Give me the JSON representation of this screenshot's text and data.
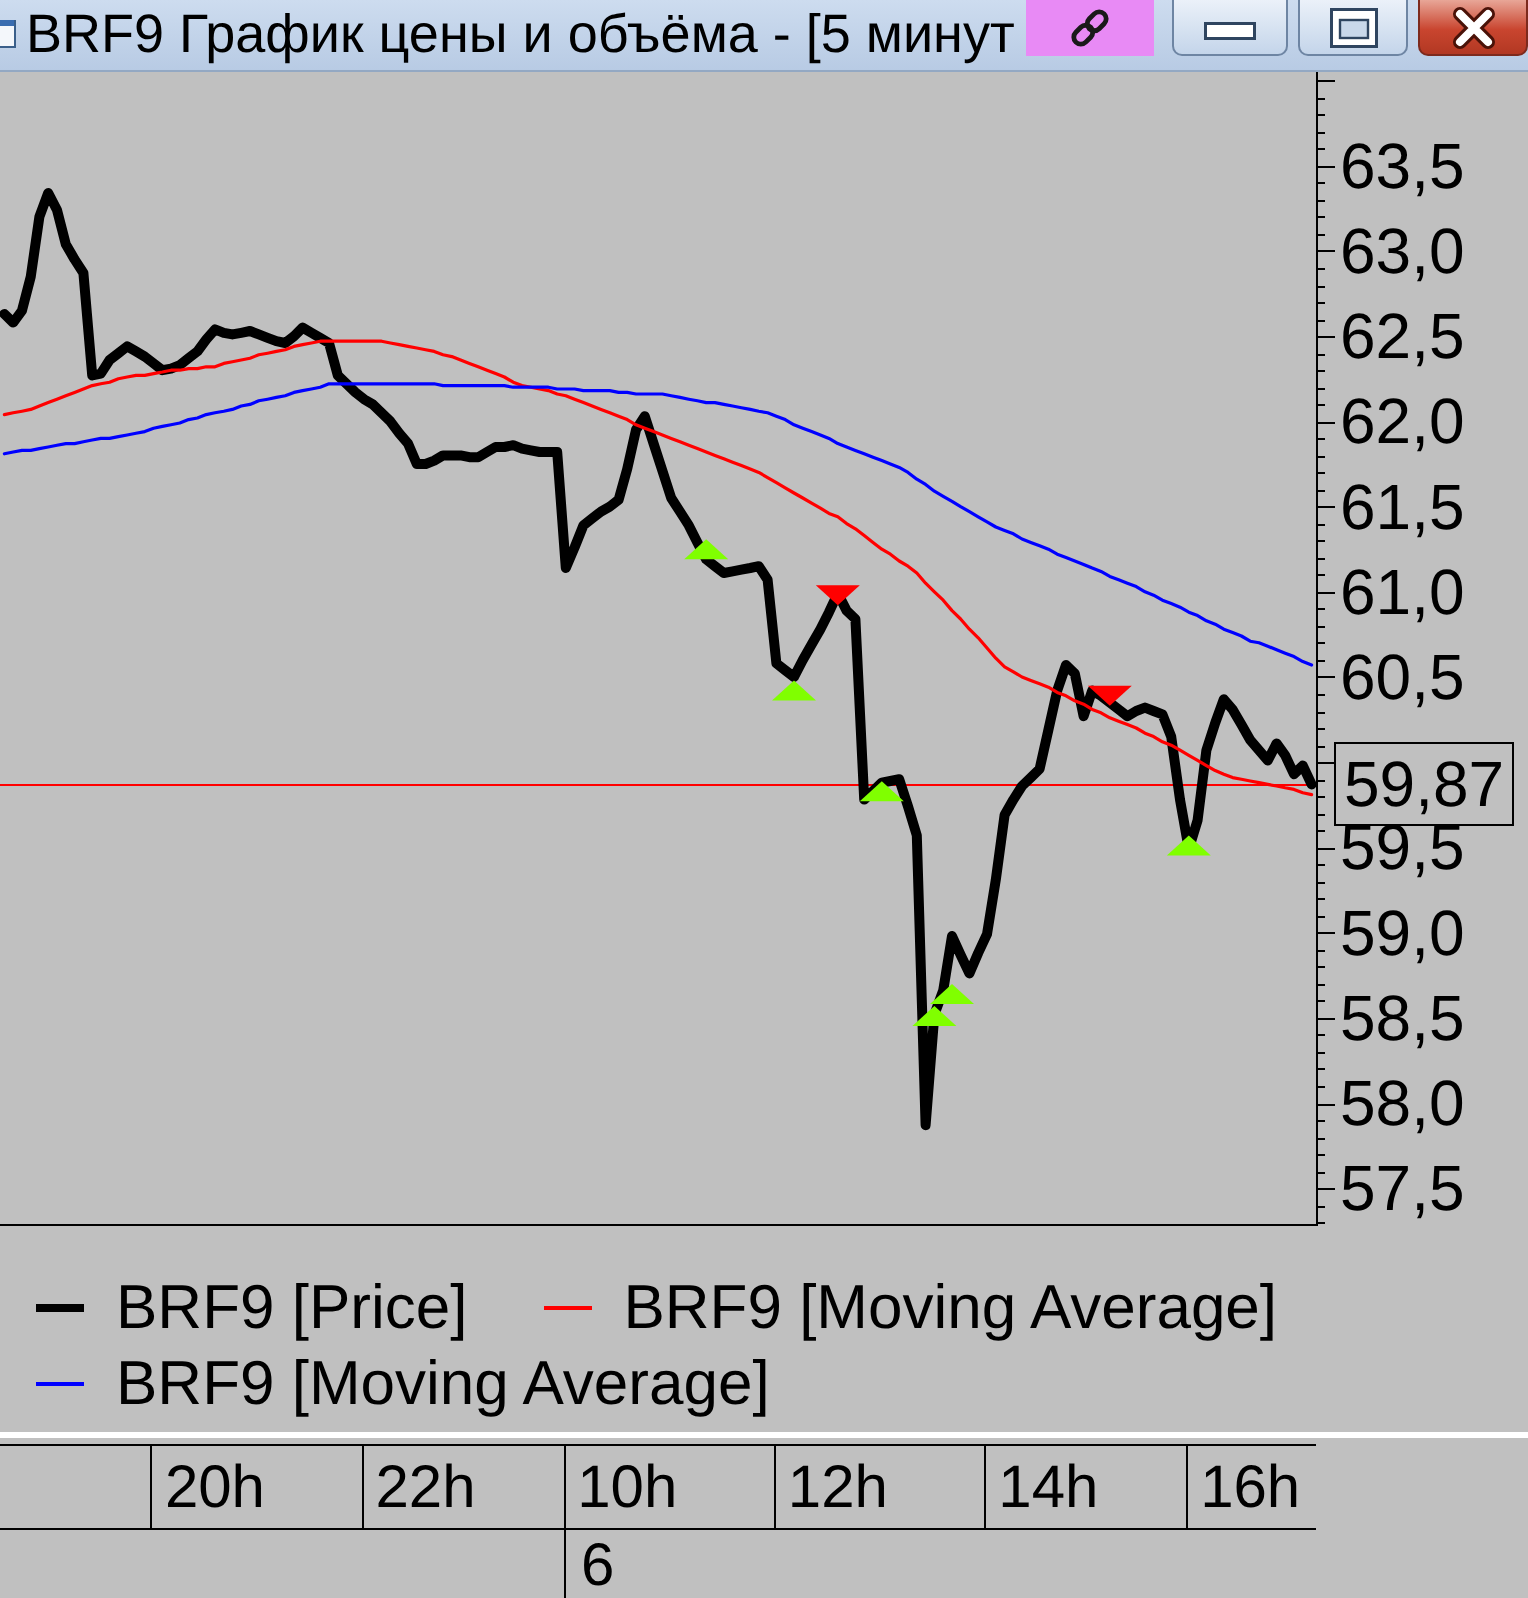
{
  "window": {
    "title": "BRF9 График цены и объёма - [5 минут",
    "buttons": [
      {
        "kind": "link"
      },
      {
        "kind": "minimize"
      },
      {
        "kind": "maximize"
      },
      {
        "kind": "close"
      }
    ]
  },
  "chart": {
    "chart_data": {
      "type": "line",
      "legend": "bottom",
      "categories": [
        null,
        null,
        null,
        null,
        null,
        null,
        null,
        null,
        null,
        null,
        null,
        null,
        null,
        null,
        null,
        null,
        null,
        null,
        null,
        null,
        null,
        null,
        null,
        null,
        "20h",
        null,
        null,
        null,
        null,
        null,
        null,
        null,
        null,
        null,
        null,
        null,
        null,
        null,
        null,
        null,
        null,
        null,
        null,
        null,
        null,
        null,
        null,
        null,
        "22h",
        null,
        null,
        null,
        null,
        null,
        null,
        null,
        null,
        null,
        null,
        null,
        null,
        null,
        null,
        null,
        null,
        null,
        null,
        null,
        null,
        null,
        null,
        "10h",
        null,
        null,
        null,
        null,
        null,
        null,
        null,
        null,
        null,
        null,
        null,
        null,
        null,
        null,
        null,
        null,
        null,
        null,
        null,
        null,
        null,
        null,
        null,
        "12h",
        null,
        null,
        null,
        null,
        null,
        null,
        null,
        null,
        null,
        null,
        null,
        null,
        null,
        null,
        null,
        null,
        null,
        null,
        null,
        null,
        null,
        null,
        null,
        "14h",
        null,
        null,
        null,
        null,
        null,
        null,
        null,
        null,
        null,
        null,
        null,
        null,
        null,
        null,
        null,
        null,
        null,
        null,
        null,
        null,
        null,
        null,
        "16h",
        null,
        null,
        null,
        null,
        null,
        null,
        null
      ],
      "series": [
        {
          "name": "BRF9 [Price]",
          "color": "#000000",
          "values": [
            62.63,
            62.58,
            62.65,
            62.85,
            63.2,
            63.34,
            63.24,
            63.04,
            62.95,
            62.87,
            62.27,
            62.28,
            62.36,
            62.4,
            62.44,
            62.41,
            62.38,
            62.34,
            62.3,
            62.31,
            62.33,
            62.37,
            62.41,
            62.48,
            62.54,
            62.52,
            62.51,
            62.52,
            62.53,
            62.51,
            62.49,
            62.47,
            62.46,
            62.5,
            62.55,
            62.52,
            62.49,
            62.46,
            62.27,
            62.22,
            62.17,
            62.13,
            62.1,
            62.05,
            62.0,
            61.93,
            61.87,
            61.75,
            61.75,
            61.77,
            61.8,
            61.8,
            61.8,
            61.79,
            61.79,
            61.82,
            61.85,
            61.85,
            61.86,
            61.84,
            61.83,
            61.82,
            61.82,
            61.82,
            61.14,
            61.26,
            61.39,
            61.43,
            61.47,
            61.5,
            61.54,
            61.72,
            61.95,
            62.03,
            61.87,
            61.71,
            61.55,
            61.47,
            61.39,
            61.29,
            61.19,
            61.15,
            61.11,
            61.12,
            61.13,
            61.14,
            61.15,
            61.07,
            60.58,
            60.54,
            60.5,
            60.6,
            60.69,
            60.78,
            60.88,
            60.99,
            60.89,
            60.84,
            59.78,
            59.83,
            59.88,
            59.89,
            59.9,
            59.74,
            59.57,
            57.87,
            58.52,
            58.66,
            58.98,
            58.87,
            58.76,
            58.88,
            58.99,
            59.31,
            59.69,
            59.78,
            59.86,
            59.91,
            59.96,
            60.19,
            60.42,
            60.57,
            60.52,
            60.27,
            60.42,
            60.39,
            60.35,
            60.31,
            60.27,
            60.3,
            60.32,
            60.3,
            60.28,
            60.15,
            59.78,
            59.49,
            59.66,
            60.07,
            60.23,
            60.37,
            60.31,
            60.22,
            60.13,
            60.07,
            60.01,
            60.11,
            60.04,
            59.93,
            59.98,
            59.87
          ]
        },
        {
          "name": "BRF9 [Moving Average]",
          "color": "#ff0000",
          "values": [
            62.04,
            62.05,
            62.06,
            62.07,
            62.09,
            62.11,
            62.13,
            62.15,
            62.17,
            62.19,
            62.21,
            62.22,
            62.23,
            62.25,
            62.26,
            62.27,
            62.27,
            62.28,
            62.29,
            62.3,
            62.3,
            62.31,
            62.31,
            62.32,
            62.32,
            62.34,
            62.35,
            62.36,
            62.37,
            62.39,
            62.4,
            62.41,
            62.42,
            62.44,
            62.45,
            62.46,
            62.47,
            62.47,
            62.47,
            62.47,
            62.47,
            62.47,
            62.47,
            62.47,
            62.46,
            62.45,
            62.44,
            62.43,
            62.42,
            62.41,
            62.39,
            62.38,
            62.36,
            62.34,
            62.32,
            62.3,
            62.28,
            62.26,
            62.23,
            62.21,
            62.2,
            62.19,
            62.18,
            62.16,
            62.15,
            62.13,
            62.11,
            62.09,
            62.07,
            62.05,
            62.03,
            62.01,
            61.98,
            61.96,
            61.94,
            61.92,
            61.9,
            61.88,
            61.86,
            61.84,
            61.82,
            61.8,
            61.78,
            61.76,
            61.74,
            61.72,
            61.7,
            61.67,
            61.64,
            61.61,
            61.58,
            61.55,
            61.52,
            61.49,
            61.46,
            61.44,
            61.4,
            61.37,
            61.33,
            61.29,
            61.25,
            61.22,
            61.18,
            61.15,
            61.11,
            61.05,
            61.0,
            60.95,
            60.89,
            60.84,
            60.78,
            60.73,
            60.67,
            60.61,
            60.56,
            60.53,
            60.5,
            60.48,
            60.46,
            60.44,
            60.41,
            60.39,
            60.36,
            60.34,
            60.31,
            60.29,
            60.26,
            60.24,
            60.22,
            60.2,
            60.17,
            60.15,
            60.12,
            60.1,
            60.07,
            60.04,
            60.01,
            59.98,
            59.95,
            59.93,
            59.91,
            59.9,
            59.89,
            59.88,
            59.87,
            59.86,
            59.85,
            59.84,
            59.82,
            59.81
          ]
        },
        {
          "name": "BRF9 [Moving Average]",
          "color": "#0000ff",
          "values": [
            61.81,
            61.82,
            61.83,
            61.83,
            61.84,
            61.85,
            61.86,
            61.87,
            61.87,
            61.88,
            61.89,
            61.9,
            61.9,
            61.91,
            61.92,
            61.93,
            61.94,
            61.96,
            61.97,
            61.98,
            61.99,
            62.01,
            62.02,
            62.04,
            62.05,
            62.06,
            62.07,
            62.09,
            62.1,
            62.12,
            62.13,
            62.14,
            62.15,
            62.17,
            62.18,
            62.19,
            62.2,
            62.22,
            62.22,
            62.22,
            62.22,
            62.22,
            62.22,
            62.22,
            62.22,
            62.22,
            62.22,
            62.22,
            62.22,
            62.22,
            62.21,
            62.21,
            62.21,
            62.21,
            62.21,
            62.21,
            62.21,
            62.21,
            62.2,
            62.2,
            62.2,
            62.2,
            62.2,
            62.19,
            62.19,
            62.19,
            62.18,
            62.18,
            62.18,
            62.18,
            62.17,
            62.17,
            62.16,
            62.16,
            62.16,
            62.16,
            62.15,
            62.14,
            62.13,
            62.12,
            62.11,
            62.11,
            62.1,
            62.09,
            62.08,
            62.07,
            62.06,
            62.05,
            62.03,
            62.01,
            61.98,
            61.96,
            61.94,
            61.92,
            61.9,
            61.87,
            61.85,
            61.83,
            61.81,
            61.79,
            61.77,
            61.75,
            61.73,
            61.7,
            61.66,
            61.63,
            61.59,
            61.56,
            61.53,
            61.5,
            61.47,
            61.44,
            61.41,
            61.38,
            61.36,
            61.34,
            61.31,
            61.29,
            61.27,
            61.25,
            61.22,
            61.2,
            61.18,
            61.16,
            61.14,
            61.12,
            61.09,
            61.07,
            61.05,
            61.03,
            61.0,
            60.98,
            60.95,
            60.93,
            60.91,
            60.88,
            60.86,
            60.83,
            60.81,
            60.78,
            60.76,
            60.74,
            60.71,
            60.7,
            60.68,
            60.66,
            60.64,
            60.62,
            60.59,
            60.57
          ]
        },
        {
          "type": "scatter",
          "color": "#80ff00",
          "marker": "triangle",
          "values": [
            null,
            null,
            null,
            null,
            null,
            null,
            null,
            null,
            null,
            null,
            null,
            null,
            null,
            null,
            null,
            null,
            null,
            null,
            null,
            null,
            null,
            null,
            null,
            null,
            null,
            null,
            null,
            null,
            null,
            null,
            null,
            null,
            null,
            null,
            null,
            null,
            null,
            null,
            null,
            null,
            null,
            null,
            null,
            null,
            null,
            null,
            null,
            null,
            null,
            null,
            null,
            null,
            null,
            null,
            null,
            null,
            null,
            null,
            null,
            null,
            null,
            null,
            null,
            null,
            null,
            null,
            null,
            null,
            null,
            null,
            null,
            null,
            null,
            null,
            null,
            null,
            null,
            null,
            null,
            null,
            61.25,
            null,
            null,
            null,
            null,
            null,
            null,
            null,
            null,
            null,
            60.42,
            null,
            null,
            null,
            null,
            null,
            null,
            null,
            null,
            null,
            59.83,
            null,
            null,
            null,
            null,
            null,
            58.51,
            null,
            58.64,
            null,
            null,
            null,
            null,
            null,
            null,
            null,
            null,
            null,
            null,
            null,
            null,
            null,
            null,
            null,
            null,
            null,
            null,
            null,
            null,
            null,
            null,
            null,
            null,
            null,
            null,
            59.51,
            null,
            null,
            null,
            null,
            null,
            null,
            null,
            null,
            null,
            null,
            null,
            null,
            null,
            null
          ]
        },
        {
          "type": "scatter",
          "color": "#ff0000",
          "marker": "triangle-down",
          "values": [
            null,
            null,
            null,
            null,
            null,
            null,
            null,
            null,
            null,
            null,
            null,
            null,
            null,
            null,
            null,
            null,
            null,
            null,
            null,
            null,
            null,
            null,
            null,
            null,
            null,
            null,
            null,
            null,
            null,
            null,
            null,
            null,
            null,
            null,
            null,
            null,
            null,
            null,
            null,
            null,
            null,
            null,
            null,
            null,
            null,
            null,
            null,
            null,
            null,
            null,
            null,
            null,
            null,
            null,
            null,
            null,
            null,
            null,
            null,
            null,
            null,
            null,
            null,
            null,
            null,
            null,
            null,
            null,
            null,
            null,
            null,
            null,
            null,
            null,
            null,
            null,
            null,
            null,
            null,
            null,
            null,
            null,
            null,
            null,
            null,
            null,
            null,
            null,
            null,
            null,
            null,
            null,
            null,
            null,
            null,
            60.98,
            null,
            null,
            null,
            null,
            null,
            null,
            null,
            null,
            null,
            null,
            null,
            null,
            null,
            null,
            null,
            null,
            null,
            null,
            null,
            null,
            null,
            null,
            null,
            null,
            null,
            null,
            null,
            null,
            null,
            null,
            60.39,
            null,
            null,
            null,
            null,
            null,
            null,
            null,
            null,
            null,
            null,
            null,
            null,
            null,
            null,
            null,
            null,
            null,
            null,
            null,
            null,
            null,
            null,
            null
          ]
        }
      ],
      "ylim": [
        57.29,
        64.05
      ],
      "yticks": [
        {
          "value": 63.5,
          "label": "63,5"
        },
        {
          "value": 63.0,
          "label": "63,0"
        },
        {
          "value": 62.5,
          "label": "62,5"
        },
        {
          "value": 62.0,
          "label": "62,0"
        },
        {
          "value": 61.5,
          "label": "61,5"
        },
        {
          "value": 61.0,
          "label": "61,0"
        },
        {
          "value": 60.5,
          "label": "60,5"
        },
        {
          "value": 59.5,
          "label": "59,5"
        },
        {
          "value": 59.0,
          "label": "59,0"
        },
        {
          "value": 58.5,
          "label": "58,5"
        },
        {
          "value": 58.0,
          "label": "58,0"
        },
        {
          "value": 57.5,
          "label": "57,5"
        }
      ],
      "ref_lines": [
        {
          "axis": "y",
          "value": 59.87,
          "label": "59,87",
          "color": "#ff0000"
        }
      ],
      "annotations": [
        "6"
      ]
    }
  }
}
